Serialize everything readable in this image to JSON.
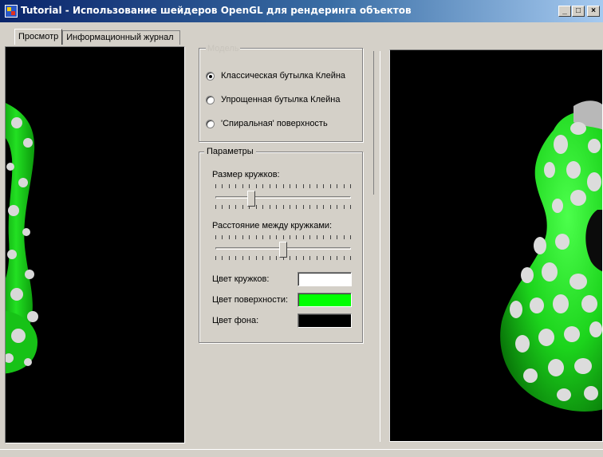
{
  "window": {
    "title": "Tutorial - Использование шейдеров OpenGL для рендеринга объектов"
  },
  "caption_buttons": {
    "minimize": "_",
    "maximize": "□",
    "close": "×"
  },
  "tabs": [
    {
      "label": "Просмотр",
      "active": true
    },
    {
      "label": "Информационный журнал",
      "active": false
    }
  ],
  "mode_group": {
    "legend": "Модель",
    "options": [
      {
        "label": "Классическая бутылка Клейна",
        "checked": true
      },
      {
        "label": "Упрощенная бутылка Клейна",
        "checked": false
      },
      {
        "label": "'Спиральная' поверхность",
        "checked": false
      }
    ]
  },
  "params_group": {
    "legend": "Параметры",
    "spot_size": {
      "label": "Размер кружков:",
      "value": 0.25
    },
    "spot_spacing": {
      "label": "Расстояние между кружками:",
      "value": 0.5
    },
    "colors": [
      {
        "label": "Цвет кружков:",
        "color": "#ffffff"
      },
      {
        "label": "Цвет поверхности:",
        "color": "#00ff00"
      },
      {
        "label": "Цвет фона:",
        "color": "#000000"
      }
    ]
  },
  "render": {
    "surface_color": "#00ff00",
    "spot_color": "#ffffff",
    "background_color": "#000000"
  }
}
